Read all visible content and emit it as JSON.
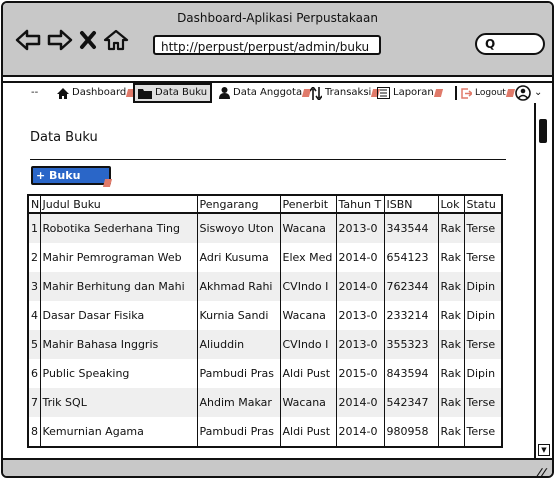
{
  "window": {
    "title": "Dashboard-Aplikasi Perpustakaan"
  },
  "browser": {
    "url": "http://perpust/perpust/admin/buku",
    "search_glyph": "Q"
  },
  "menu": {
    "lead": "--",
    "items": [
      {
        "label": "Dashboard",
        "icon": "home-icon"
      },
      {
        "label": "Data Buku",
        "icon": "folder-icon"
      },
      {
        "label": "Data Anggota",
        "icon": "user-icon"
      },
      {
        "label": "Transaksi",
        "icon": "sort-icon"
      },
      {
        "label": "Laporan",
        "icon": "list-icon"
      },
      {
        "label": "Logout",
        "icon": "logout-icon"
      }
    ],
    "profile_caret": "⌄"
  },
  "page": {
    "title": "Data Buku",
    "add_button": "+ Buku Baru"
  },
  "table": {
    "headers": [
      "N",
      "Judul Buku",
      "Pengarang",
      "Penerbit",
      "Tahun T",
      "ISBN",
      "Lok",
      "Statu"
    ],
    "rows": [
      [
        "1",
        "Robotika Sederhana Ting",
        "Siswoyo Uton",
        "Wacana",
        "2013-0",
        "343544",
        "Rak",
        "Terse"
      ],
      [
        "2",
        "Mahir Pemrograman Web",
        "Adri Kusuma",
        "Elex Med",
        "2014-0",
        "654123",
        "Rak",
        "Terse"
      ],
      [
        "3",
        "Mahir Berhitung dan Mahi",
        "Akhmad Rahi",
        "CVIndo I",
        "2014-0",
        "762344",
        "Rak",
        "Dipin"
      ],
      [
        "4",
        "Dasar Dasar Fisika",
        "Kurnia Sandi",
        "Wacana",
        "2013-0",
        "233214",
        "Rak",
        "Dipin"
      ],
      [
        "5",
        "Mahir Bahasa Inggris",
        "Aliuddin",
        "CVIndo I",
        "2013-0",
        "355323",
        "Rak",
        "Terse"
      ],
      [
        "6",
        "Public Speaking",
        "Pambudi Pras",
        "Aldi Pust",
        "2015-0",
        "843594",
        "Rak",
        "Dipin"
      ],
      [
        "7",
        "Trik SQL",
        "Ahdim Makar",
        "Wacana",
        "2014-0",
        "542347",
        "Rak",
        "Terse"
      ],
      [
        "8",
        "Kemurnian Agama",
        "Pambudi Pras",
        "Aldi Pust",
        "2014-0",
        "980958",
        "Rak",
        "Terse"
      ]
    ]
  },
  "statusbar": {
    "grip": "//"
  }
}
